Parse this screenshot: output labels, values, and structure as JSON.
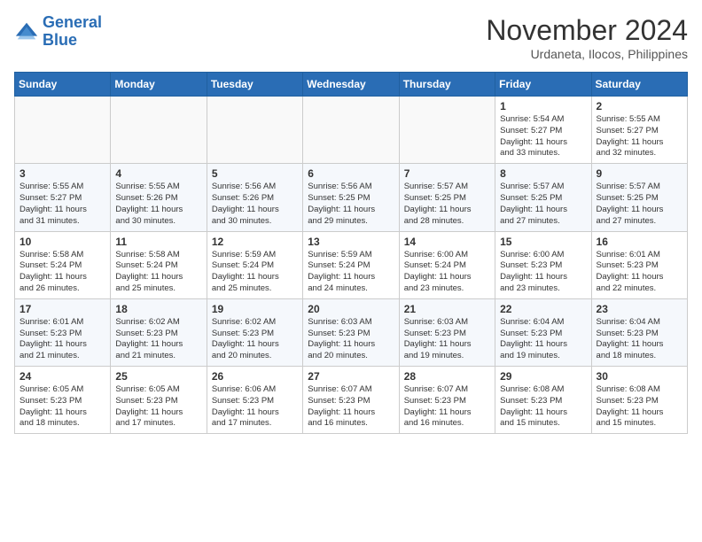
{
  "header": {
    "logo_line1": "General",
    "logo_line2": "Blue",
    "month": "November 2024",
    "location": "Urdaneta, Ilocos, Philippines"
  },
  "weekdays": [
    "Sunday",
    "Monday",
    "Tuesday",
    "Wednesday",
    "Thursday",
    "Friday",
    "Saturday"
  ],
  "weeks": [
    [
      {
        "day": "",
        "info": ""
      },
      {
        "day": "",
        "info": ""
      },
      {
        "day": "",
        "info": ""
      },
      {
        "day": "",
        "info": ""
      },
      {
        "day": "",
        "info": ""
      },
      {
        "day": "1",
        "info": "Sunrise: 5:54 AM\nSunset: 5:27 PM\nDaylight: 11 hours\nand 33 minutes."
      },
      {
        "day": "2",
        "info": "Sunrise: 5:55 AM\nSunset: 5:27 PM\nDaylight: 11 hours\nand 32 minutes."
      }
    ],
    [
      {
        "day": "3",
        "info": "Sunrise: 5:55 AM\nSunset: 5:27 PM\nDaylight: 11 hours\nand 31 minutes."
      },
      {
        "day": "4",
        "info": "Sunrise: 5:55 AM\nSunset: 5:26 PM\nDaylight: 11 hours\nand 30 minutes."
      },
      {
        "day": "5",
        "info": "Sunrise: 5:56 AM\nSunset: 5:26 PM\nDaylight: 11 hours\nand 30 minutes."
      },
      {
        "day": "6",
        "info": "Sunrise: 5:56 AM\nSunset: 5:25 PM\nDaylight: 11 hours\nand 29 minutes."
      },
      {
        "day": "7",
        "info": "Sunrise: 5:57 AM\nSunset: 5:25 PM\nDaylight: 11 hours\nand 28 minutes."
      },
      {
        "day": "8",
        "info": "Sunrise: 5:57 AM\nSunset: 5:25 PM\nDaylight: 11 hours\nand 27 minutes."
      },
      {
        "day": "9",
        "info": "Sunrise: 5:57 AM\nSunset: 5:25 PM\nDaylight: 11 hours\nand 27 minutes."
      }
    ],
    [
      {
        "day": "10",
        "info": "Sunrise: 5:58 AM\nSunset: 5:24 PM\nDaylight: 11 hours\nand 26 minutes."
      },
      {
        "day": "11",
        "info": "Sunrise: 5:58 AM\nSunset: 5:24 PM\nDaylight: 11 hours\nand 25 minutes."
      },
      {
        "day": "12",
        "info": "Sunrise: 5:59 AM\nSunset: 5:24 PM\nDaylight: 11 hours\nand 25 minutes."
      },
      {
        "day": "13",
        "info": "Sunrise: 5:59 AM\nSunset: 5:24 PM\nDaylight: 11 hours\nand 24 minutes."
      },
      {
        "day": "14",
        "info": "Sunrise: 6:00 AM\nSunset: 5:24 PM\nDaylight: 11 hours\nand 23 minutes."
      },
      {
        "day": "15",
        "info": "Sunrise: 6:00 AM\nSunset: 5:23 PM\nDaylight: 11 hours\nand 23 minutes."
      },
      {
        "day": "16",
        "info": "Sunrise: 6:01 AM\nSunset: 5:23 PM\nDaylight: 11 hours\nand 22 minutes."
      }
    ],
    [
      {
        "day": "17",
        "info": "Sunrise: 6:01 AM\nSunset: 5:23 PM\nDaylight: 11 hours\nand 21 minutes."
      },
      {
        "day": "18",
        "info": "Sunrise: 6:02 AM\nSunset: 5:23 PM\nDaylight: 11 hours\nand 21 minutes."
      },
      {
        "day": "19",
        "info": "Sunrise: 6:02 AM\nSunset: 5:23 PM\nDaylight: 11 hours\nand 20 minutes."
      },
      {
        "day": "20",
        "info": "Sunrise: 6:03 AM\nSunset: 5:23 PM\nDaylight: 11 hours\nand 20 minutes."
      },
      {
        "day": "21",
        "info": "Sunrise: 6:03 AM\nSunset: 5:23 PM\nDaylight: 11 hours\nand 19 minutes."
      },
      {
        "day": "22",
        "info": "Sunrise: 6:04 AM\nSunset: 5:23 PM\nDaylight: 11 hours\nand 19 minutes."
      },
      {
        "day": "23",
        "info": "Sunrise: 6:04 AM\nSunset: 5:23 PM\nDaylight: 11 hours\nand 18 minutes."
      }
    ],
    [
      {
        "day": "24",
        "info": "Sunrise: 6:05 AM\nSunset: 5:23 PM\nDaylight: 11 hours\nand 18 minutes."
      },
      {
        "day": "25",
        "info": "Sunrise: 6:05 AM\nSunset: 5:23 PM\nDaylight: 11 hours\nand 17 minutes."
      },
      {
        "day": "26",
        "info": "Sunrise: 6:06 AM\nSunset: 5:23 PM\nDaylight: 11 hours\nand 17 minutes."
      },
      {
        "day": "27",
        "info": "Sunrise: 6:07 AM\nSunset: 5:23 PM\nDaylight: 11 hours\nand 16 minutes."
      },
      {
        "day": "28",
        "info": "Sunrise: 6:07 AM\nSunset: 5:23 PM\nDaylight: 11 hours\nand 16 minutes."
      },
      {
        "day": "29",
        "info": "Sunrise: 6:08 AM\nSunset: 5:23 PM\nDaylight: 11 hours\nand 15 minutes."
      },
      {
        "day": "30",
        "info": "Sunrise: 6:08 AM\nSunset: 5:23 PM\nDaylight: 11 hours\nand 15 minutes."
      }
    ]
  ]
}
